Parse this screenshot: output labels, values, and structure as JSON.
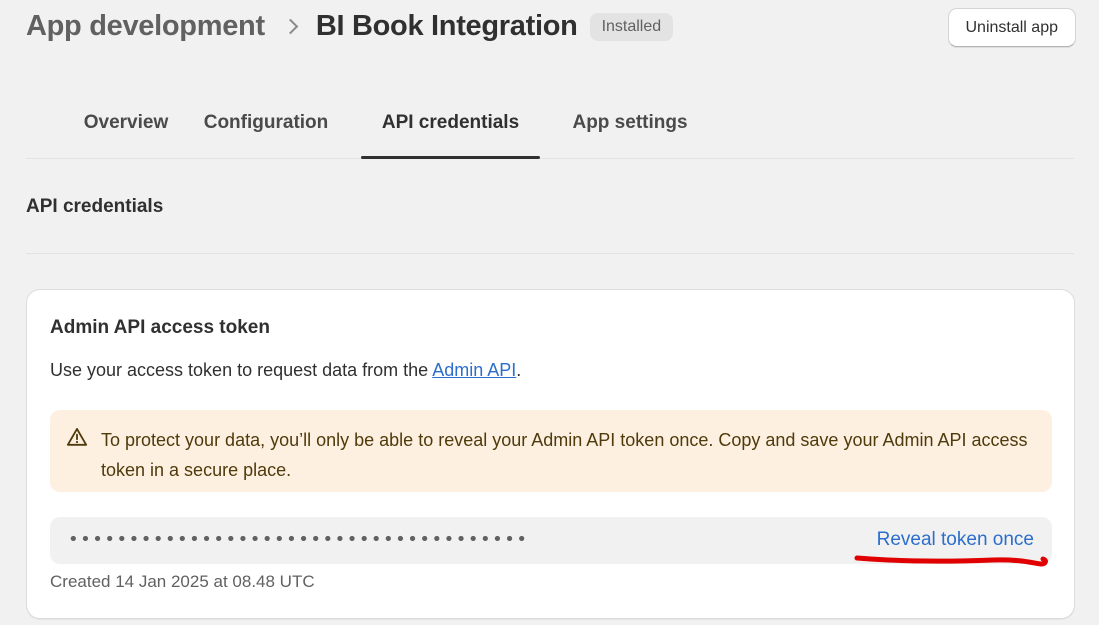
{
  "header": {
    "breadcrumb_parent": "App development",
    "breadcrumb_current": "BI Book Integration",
    "status_badge": "Installed",
    "uninstall_label": "Uninstall app"
  },
  "tabs": [
    {
      "label": "Overview",
      "active": false
    },
    {
      "label": "Configuration",
      "active": false
    },
    {
      "label": "API credentials",
      "active": true
    },
    {
      "label": "App settings",
      "active": false
    }
  ],
  "section": {
    "title": "API credentials"
  },
  "card": {
    "title": "Admin API access token",
    "desc_prefix": "Use your access token to request data from the ",
    "desc_link": "Admin API",
    "desc_suffix": ".",
    "warning": "To protect your data, you’ll only be able to reveal your Admin API token once. Copy and save your Admin API access token in a secure place.",
    "warning_icon": "alert-triangle-icon",
    "token_mask": "••••••••••••••••••••••••••••••••••••••",
    "reveal_label": "Reveal token once",
    "created": "Created 14 Jan 2025 at 08.48 UTC"
  },
  "colors": {
    "background": "#f1f1f1",
    "link": "#2c6ecb",
    "warning_bg": "#fdf0e0",
    "annotation_red": "#e00000"
  }
}
